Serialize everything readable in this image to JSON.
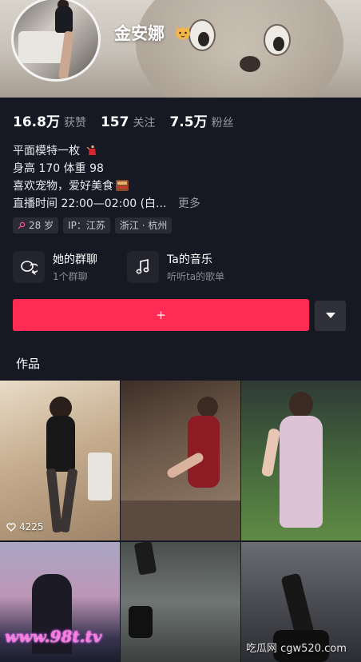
{
  "profile": {
    "username": "金安娜",
    "stats": [
      {
        "num": "16.8万",
        "label": "获赞"
      },
      {
        "num": "157",
        "label": "关注"
      },
      {
        "num": "7.5万",
        "label": "粉丝"
      }
    ],
    "bio": {
      "line1": "平面模特一枚",
      "line2": "身高 170 体重 98",
      "line3": "喜欢宠物，爱好美食",
      "line4": "直播时间 22:00—02:00 (白...",
      "more": "更多"
    },
    "tags": [
      "28 岁",
      "IP：江苏",
      "浙江 · 杭州"
    ]
  },
  "shortcuts": [
    {
      "title": "她的群聊",
      "sub": "1个群聊",
      "icon": "chat-group-icon"
    },
    {
      "title": "Ta的音乐",
      "sub": "听听ta的歌单",
      "icon": "music-note-icon"
    }
  ],
  "follow_button": "+",
  "works_title": "作品",
  "grid": {
    "likes_first": "4225"
  },
  "watermarks": {
    "left": "www.98t.tv",
    "right": "吃瓜网 cgw520.com"
  },
  "colors": {
    "accent": "#fe2c55",
    "background": "#161823"
  }
}
